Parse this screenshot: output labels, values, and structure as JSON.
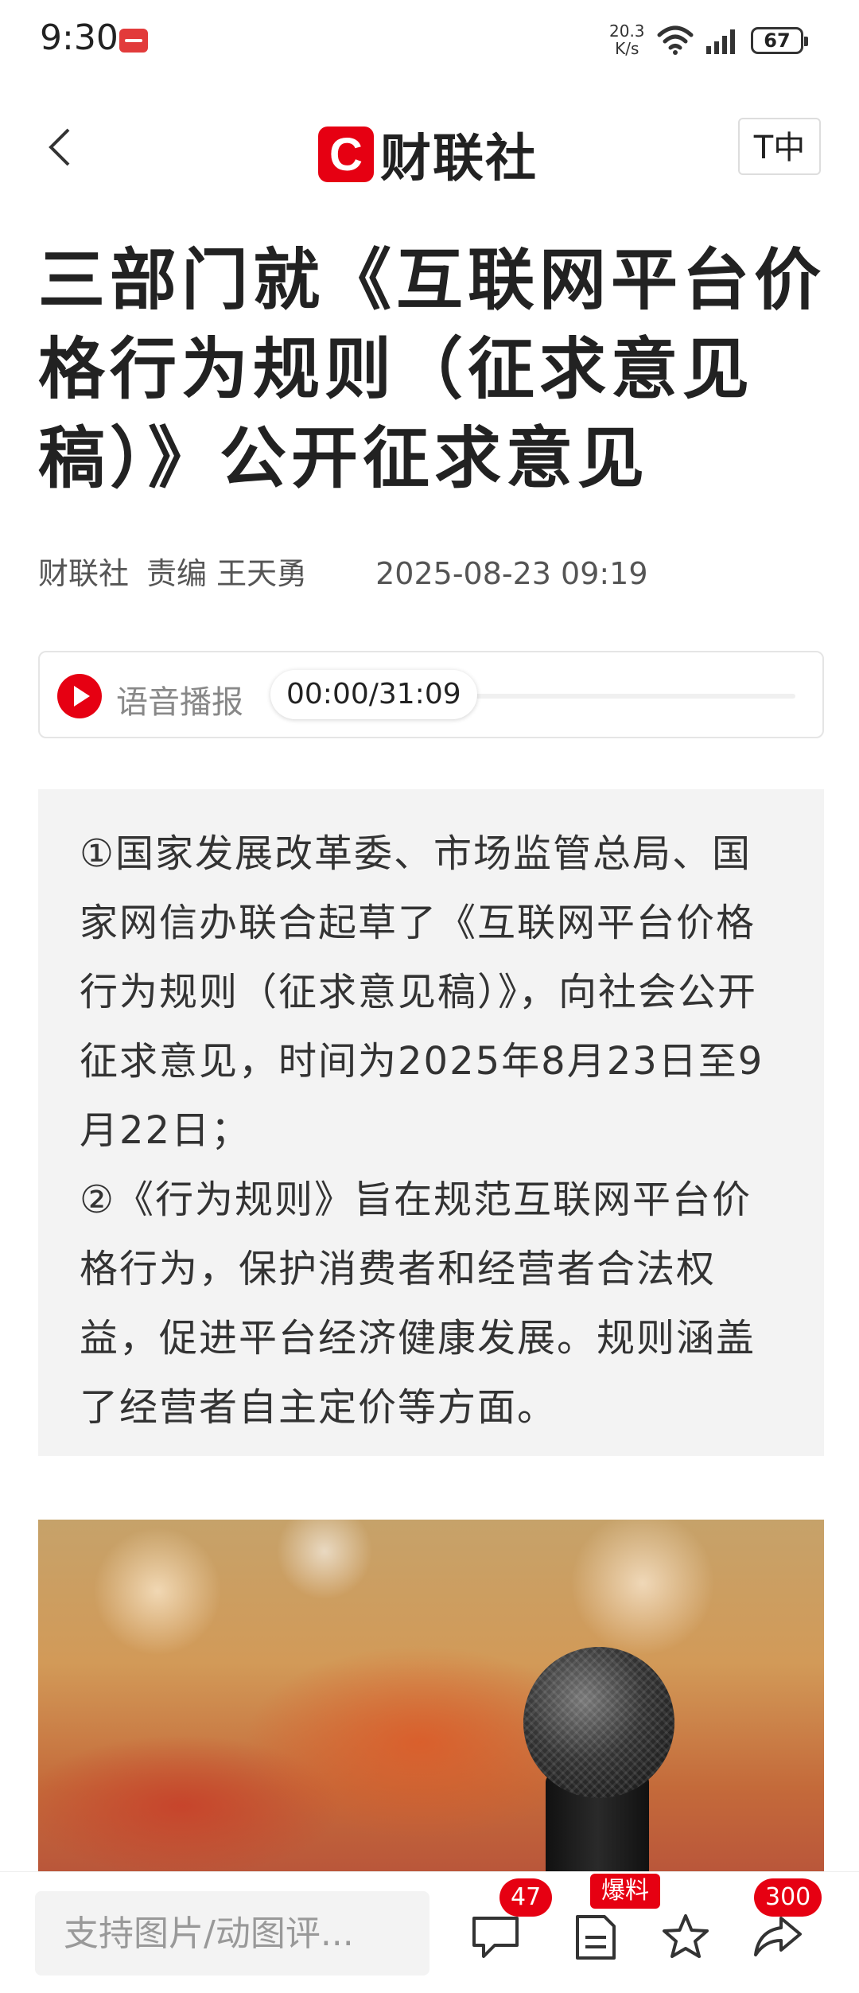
{
  "status_bar": {
    "time": "9:30",
    "net_speed_value": "20.3",
    "net_speed_unit": "K/s",
    "battery": "67"
  },
  "header": {
    "logo_mark": "C",
    "logo_text": "财联社",
    "font_size_label": "T中"
  },
  "article": {
    "title": "三部门就《互联网平台价格行为规则（征求意见稿）》公开征求意见",
    "source": "财联社",
    "editor": "责编 王天勇",
    "datetime": "2025-08-23 09:19"
  },
  "audio": {
    "label": "语音播报",
    "time": "00:00/31:09",
    "progress": 0
  },
  "summary": {
    "point1": "①国家发展改革委、市场监管总局、国家网信办联合起草了《互联网平台价格行为规则（征求意见稿）》，向社会公开征求意见，时间为2025年8月23日至9月22日；",
    "point2": "②《行为规则》旨在规范互联网平台价格行为，保护消费者和经营者合法权益，促进平台经济健康发展。规则涵盖了经营者自主定价等方面。"
  },
  "bottom_bar": {
    "comment_placeholder": "支持图片/动图评...",
    "comment_count": "47",
    "report_badge": "爆料",
    "share_count": "300"
  },
  "colors": {
    "brand": "#e60012",
    "summary_bg": "#f3f3f3"
  },
  "icons": [
    "back-arrow-icon",
    "wifi-icon",
    "signal-icon",
    "play-icon",
    "comment-icon",
    "report-icon",
    "star-icon",
    "share-icon"
  ]
}
